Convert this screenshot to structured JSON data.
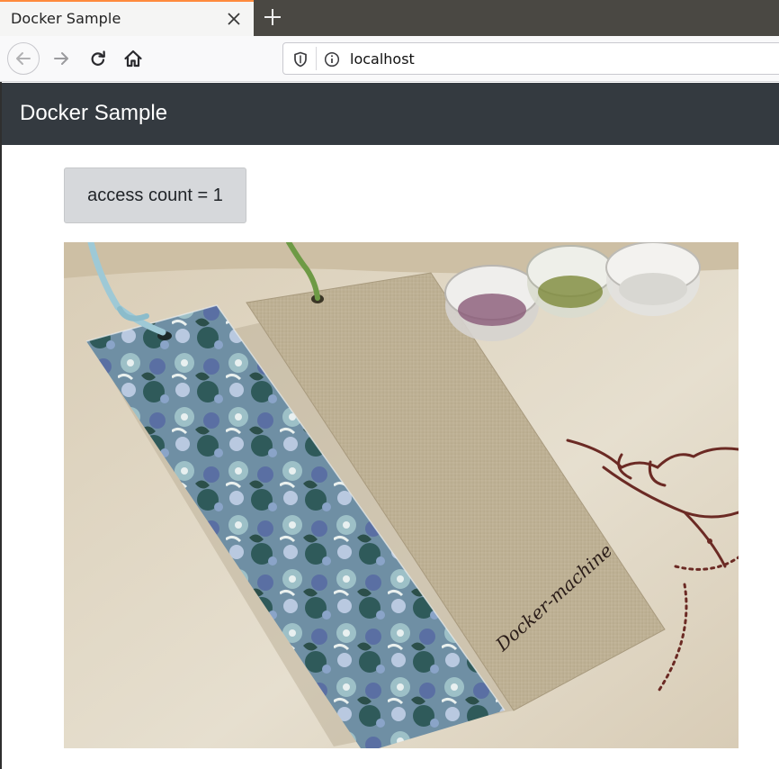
{
  "browser": {
    "tab_title": "Docker Sample",
    "url": "localhost",
    "icons": {
      "close": "close-icon",
      "new_tab": "plus-icon",
      "back": "back-arrow-icon",
      "forward": "forward-arrow-icon",
      "reload": "reload-icon",
      "home": "home-icon",
      "tracking": "shield-icon",
      "site_info": "info-icon"
    }
  },
  "page": {
    "brand": "Docker Sample",
    "access_count_label": "access count = 1",
    "photo": {
      "subject": "fabric bookmarks with floral pattern and linen, jars of beads",
      "handwriting": "Docker-machine"
    }
  },
  "colors": {
    "navbar": "#343a40",
    "button": "#d6d8db",
    "tab_accent": "#ff8a3d"
  }
}
